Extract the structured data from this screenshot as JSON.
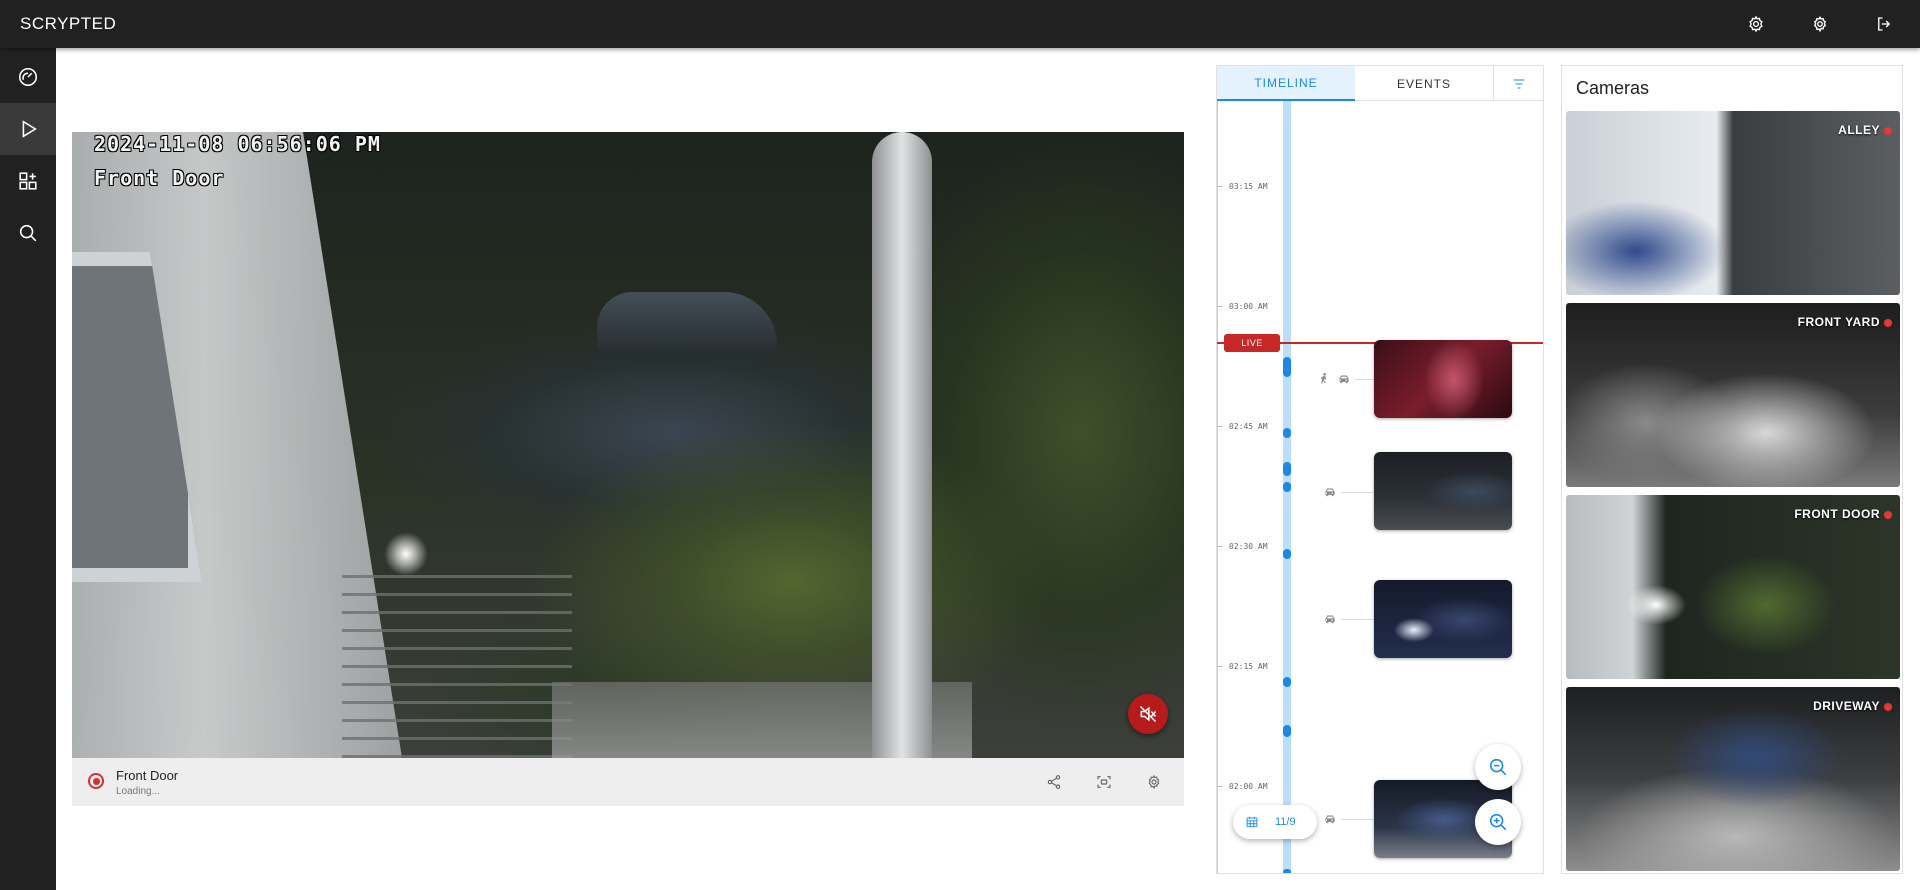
{
  "app": {
    "brand": "SCRYPTED"
  },
  "topbar": {
    "icons": [
      "gear-icon",
      "settings-icon",
      "logout-icon"
    ]
  },
  "rail": {
    "items": [
      {
        "name": "dashboard",
        "icon": "gauge-icon",
        "active": false
      },
      {
        "name": "video",
        "icon": "play-icon",
        "active": true
      },
      {
        "name": "plugins",
        "icon": "apps-add-icon",
        "active": false
      },
      {
        "name": "search",
        "icon": "search-icon",
        "active": false
      }
    ]
  },
  "video": {
    "osd_timestamp": "2024-11-08 06:56:06 PM",
    "osd_camera": "Front Door",
    "camera_name": "Front Door",
    "status": "Loading..."
  },
  "timeline": {
    "tabs": [
      {
        "label": "TIMELINE",
        "active": true
      },
      {
        "label": "EVENTS",
        "active": false
      }
    ],
    "live_label": "LIVE",
    "ticks": [
      "03:15 AM",
      "03:00 AM",
      "02:45 AM",
      "02:30 AM",
      "02:15 AM",
      "02:00 AM"
    ],
    "date": "11/9",
    "events": [
      {
        "icons": [
          "person-icon",
          "car-icon"
        ]
      },
      {
        "icons": [
          "car-icon"
        ]
      },
      {
        "icons": [
          "car-icon"
        ]
      },
      {
        "icons": [
          "car-icon"
        ]
      }
    ]
  },
  "cameras": {
    "title": "Cameras",
    "items": [
      {
        "label": "ALLEY"
      },
      {
        "label": "FRONT YARD"
      },
      {
        "label": "FRONT DOOR"
      },
      {
        "label": "DRIVEWAY"
      }
    ]
  },
  "colors": {
    "accent": "#1e88e5",
    "live": "#c62828",
    "topbar": "#212121"
  }
}
